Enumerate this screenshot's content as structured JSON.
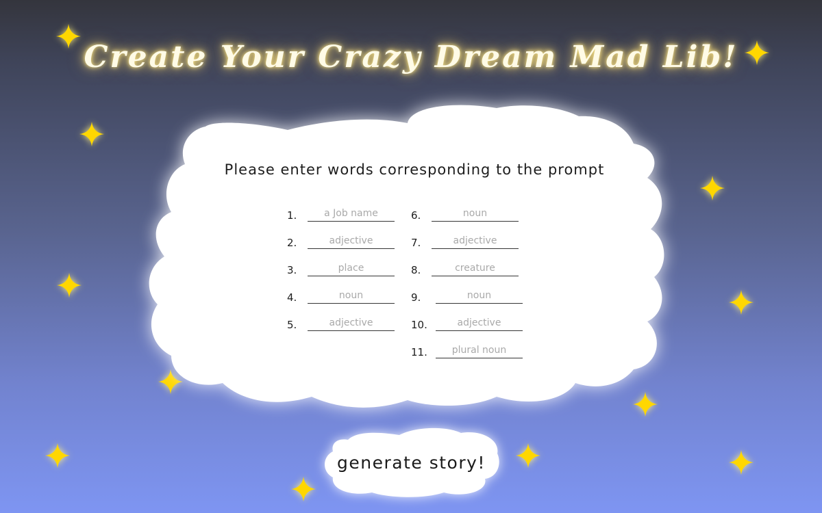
{
  "title": "Create Your Crazy Dream Mad Lib!",
  "prompt": "Please enter words corresponding to the prompt",
  "fields": [
    {
      "number": "1.",
      "placeholder": "a Job name"
    },
    {
      "number": "2.",
      "placeholder": "adjective"
    },
    {
      "number": "3.",
      "placeholder": "place"
    },
    {
      "number": "4.",
      "placeholder": "noun"
    },
    {
      "number": "5.",
      "placeholder": "adjective"
    },
    {
      "number": "6.",
      "placeholder": "noun"
    },
    {
      "number": "7.",
      "placeholder": "adjective"
    },
    {
      "number": "8.",
      "placeholder": "creature"
    },
    {
      "number": "9.",
      "placeholder": "noun"
    },
    {
      "number": "10.",
      "placeholder": "adjective"
    },
    {
      "number": "11.",
      "placeholder": "plural noun"
    }
  ],
  "button": {
    "label": "generate story!"
  },
  "colors": {
    "star": "#ffd700",
    "cloud": "#ffffff",
    "title_glow": "#ffe98a"
  },
  "icons": {
    "star": "sparkle-star-icon"
  }
}
